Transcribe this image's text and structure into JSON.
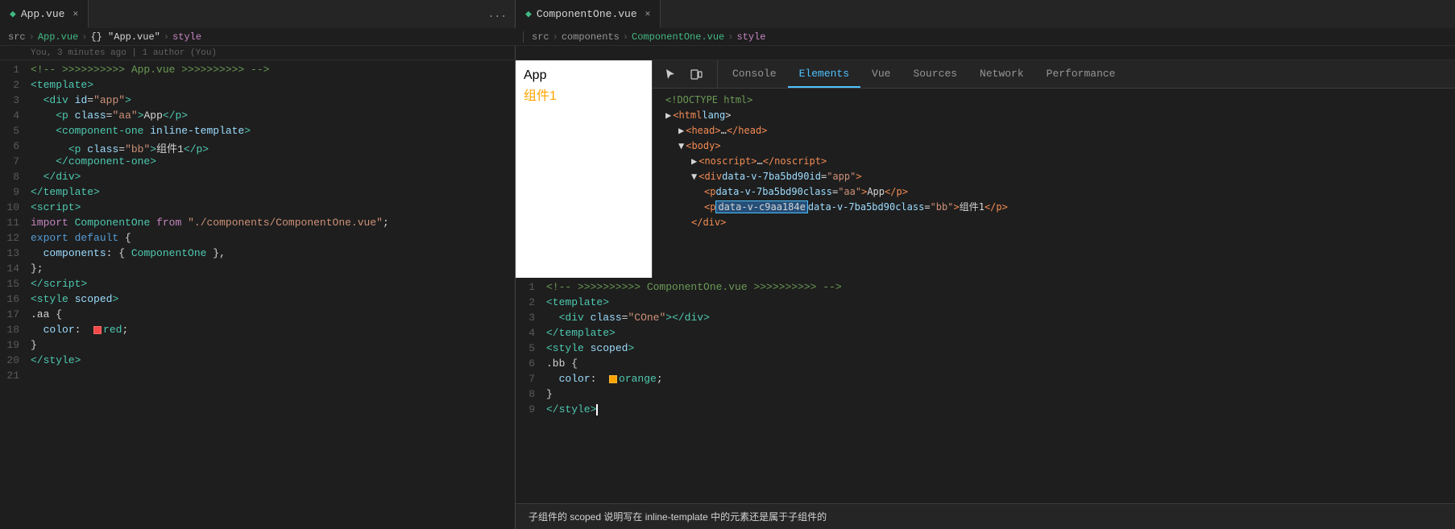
{
  "tabs": {
    "left": {
      "items": [
        {
          "id": "app-vue",
          "label": "App.vue",
          "active": true,
          "icon": "vue"
        }
      ],
      "more": "..."
    },
    "right": {
      "items": [
        {
          "id": "component-one-vue",
          "label": "ComponentOne.vue",
          "active": true,
          "icon": "vue"
        }
      ]
    }
  },
  "breadcrumbs": {
    "left": [
      "src",
      ">",
      "App.vue",
      ">",
      "{} \"App.vue\"",
      ">",
      "style"
    ],
    "right": [
      "src",
      ">",
      "components",
      ">",
      "ComponentOne.vue",
      ">",
      "style"
    ]
  },
  "git_info": "You, 3 minutes ago | 1 author (You)",
  "editor_left": {
    "lines": [
      {
        "num": 1,
        "html": "<span class='t-comment'>&lt;!-- &gt;&gt;&gt;&gt;&gt;&gt;&gt;&gt;&gt;&gt; App.vue &gt;&gt;&gt;&gt;&gt;&gt;&gt;&gt;&gt;&gt; --&gt;</span>"
      },
      {
        "num": 2,
        "html": "<span class='t-tag'>&lt;template&gt;</span>"
      },
      {
        "num": 3,
        "html": "  <span class='t-tag'>&lt;div</span> <span class='t-attr-name'>id</span><span class='t-white'>=</span><span class='t-attr-value'>\"app\"</span><span class='t-tag'>&gt;</span>"
      },
      {
        "num": 4,
        "html": "    <span class='t-tag'>&lt;p</span> <span class='t-attr-name'>class</span><span class='t-white'>=</span><span class='t-attr-value'>\"aa\"</span><span class='t-tag'>&gt;</span><span class='t-white'>App</span><span class='t-tag'>&lt;/p&gt;</span>"
      },
      {
        "num": 5,
        "html": "    <span class='t-tag'>&lt;component-one</span> <span class='t-attr-name'>inline-template</span><span class='t-tag'>&gt;</span>"
      },
      {
        "num": 6,
        "html": "      <span class='t-tag'>&lt;p</span> <span class='t-attr-name'>class</span><span class='t-white'>=</span><span class='t-attr-value'>\"bb\"</span><span class='t-tag'>&gt;</span><span class='t-white'>组件1</span><span class='t-tag'>&lt;/p&gt;</span>"
      },
      {
        "num": 7,
        "html": "    <span class='t-tag'>&lt;/component-one&gt;</span>"
      },
      {
        "num": 8,
        "html": "  <span class='t-tag'>&lt;/div&gt;</span>"
      },
      {
        "num": 9,
        "html": "<span class='t-tag'>&lt;/template&gt;</span>"
      },
      {
        "num": 10,
        "html": "<span class='t-tag'>&lt;script&gt;</span>"
      },
      {
        "num": 11,
        "html": "<span class='t-import'>import</span> <span class='t-cyan'>ComponentOne</span> <span class='t-import'>from</span> <span class='t-string'>\"./components/ComponentOne.vue\"</span><span class='t-white'>;</span>"
      },
      {
        "num": 12,
        "html": "<span class='t-blue'>export</span> <span class='t-blue'>default</span> <span class='t-white'>{</span>"
      },
      {
        "num": 13,
        "html": "  <span class='t-prop'>components</span><span class='t-white'>: {</span> <span class='t-cyan'>ComponentOne</span> <span class='t-white'>},</span>"
      },
      {
        "num": 14,
        "html": "<span class='t-white'>};</span>"
      },
      {
        "num": 15,
        "html": "<span class='t-tag'>&lt;/script&gt;</span>"
      },
      {
        "num": 16,
        "html": "<span class='t-tag'>&lt;style</span> <span class='t-attr-name'>scoped</span><span class='t-tag'>&gt;</span>"
      },
      {
        "num": 17,
        "html": "<span class='t-white'>.aa {</span>"
      },
      {
        "num": 18,
        "html": "  <span class='t-prop'>color</span><span class='t-white'>:  <span class='color-swatch' style='background:#f44747'></span></span><span class='t-tag'>red</span><span class='t-white'>;</span>"
      },
      {
        "num": 19,
        "html": "<span class='t-white'>}</span>"
      },
      {
        "num": 20,
        "html": "<span class='t-tag'>&lt;/style&gt;</span>"
      },
      {
        "num": 21,
        "html": ""
      }
    ]
  },
  "editor_right": {
    "lines": [
      {
        "num": 1,
        "html": "<span class='t-comment'>&lt;!-- &gt;&gt;&gt;&gt;&gt;&gt;&gt;&gt;&gt;&gt; ComponentOne.vue &gt;&gt;&gt;&gt;&gt;&gt;&gt;&gt;&gt;&gt; --&gt;</span>"
      },
      {
        "num": 2,
        "html": "<span class='t-tag'>&lt;template&gt;</span>"
      },
      {
        "num": 3,
        "html": "  <span class='t-tag'>&lt;div</span> <span class='t-attr-name'>class</span><span class='t-white'>=</span><span class='t-attr-value'>\"COne\"</span><span class='t-tag'>&gt;&lt;/div&gt;</span>"
      },
      {
        "num": 4,
        "html": "<span class='t-tag'>&lt;/template&gt;</span>"
      },
      {
        "num": 5,
        "html": "<span class='t-tag'>&lt;style</span> <span class='t-attr-name'>scoped</span><span class='t-tag'>&gt;</span>"
      },
      {
        "num": 6,
        "html": "<span class='t-white'>.bb {</span>"
      },
      {
        "num": 7,
        "html": "  <span class='t-prop'>color</span><span class='t-white'>:  <span class='color-swatch' style='background:orange'></span></span><span class='t-tag'>orange</span><span class='t-white'>;</span>"
      },
      {
        "num": 8,
        "html": "<span class='t-white'>}</span>"
      },
      {
        "num": 9,
        "html": "<span class='t-tag'>&lt;/style&gt;</span><span class='cursor-blink'></span>"
      }
    ]
  },
  "preview": {
    "app_label": "App",
    "comp1_label": "组件1"
  },
  "devtools": {
    "tab_icons": [
      "cursor-icon",
      "device-icon"
    ],
    "tabs": [
      {
        "label": "Console",
        "active": false
      },
      {
        "label": "Elements",
        "active": true
      },
      {
        "label": "Vue",
        "active": false
      },
      {
        "label": "Sources",
        "active": false
      },
      {
        "label": "Network",
        "active": false
      },
      {
        "label": "Performance",
        "active": false
      }
    ],
    "dom_lines": [
      {
        "indent": 0,
        "html": "<span class='dom-comment'>&lt;!DOCTYPE html&gt;</span>"
      },
      {
        "indent": 0,
        "html": "<span class='dom-triangle'>▶</span><span class='dom-tag'>&lt;html</span> <span class='dom-attr-name'>lang</span><span class='t-white'>&gt;</span>"
      },
      {
        "indent": 1,
        "html": "<span class='dom-triangle'>▶</span><span class='dom-tag'>&lt;head&gt;</span><span class='t-white'>…</span><span class='dom-tag'>&lt;/head&gt;</span>"
      },
      {
        "indent": 1,
        "html": "<span class='dom-triangle'>▼</span><span class='dom-tag'>&lt;body&gt;</span>"
      },
      {
        "indent": 2,
        "html": "<span class='dom-triangle'>▶</span><span class='dom-tag'>&lt;noscript&gt;</span><span class='t-white'>…</span><span class='dom-tag'>&lt;/noscript&gt;</span>"
      },
      {
        "indent": 2,
        "html": "<span class='dom-triangle'>▼</span> <span class='dom-tag'>&lt;div</span> <span class='dom-attr-name'>data-v-7ba5bd90</span> <span class='dom-attr-name'>id</span><span class='t-white'>=</span><span class='dom-attr-val'>\"app\"</span><span class='dom-tag'>&gt;</span>"
      },
      {
        "indent": 3,
        "html": "<span class='dom-tag'>&lt;p</span> <span class='dom-attr-name'>data-v-7ba5bd90</span> <span class='dom-attr-name'>class</span><span class='t-white'>=</span><span class='dom-attr-val'>\"aa\"</span><span class='dom-tag'>&gt;</span><span class='t-white'>App</span><span class='dom-tag'>&lt;/p&gt;</span>"
      },
      {
        "indent": 3,
        "html": "<span class='dom-tag'>&lt;p</span> <span class='dom-highlight'>data-v-c9aa184e</span> <span class='dom-attr-name'>data-v-7ba5bd90</span> <span class='dom-attr-name'>class</span><span class='t-white'>=</span><span class='dom-attr-val'>\"bb\"</span><span class='dom-tag'>&gt;</span><span class='t-white'>组件1</span><span class='dom-tag'>&lt;/p&gt;</span>"
      },
      {
        "indent": 2,
        "html": "<span class='dom-tag'>&lt;/div&gt;</span>"
      }
    ]
  },
  "bottom_tooltip": "子组件的 scoped 说明写在 inline-template 中的元素还是属于子组件的"
}
